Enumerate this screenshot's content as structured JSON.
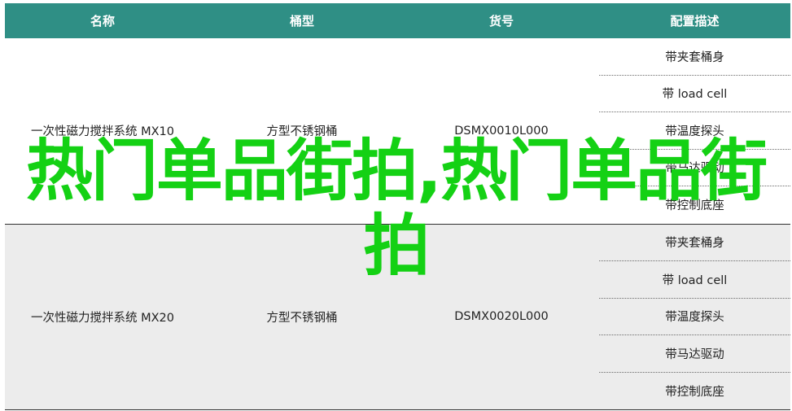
{
  "table": {
    "headers": [
      "名称",
      "桶型",
      "货号",
      "配置描述"
    ],
    "rows": [
      {
        "name": "一次性磁力搅拌系统 MX10",
        "type": "方型不锈钢桶",
        "code": "DSMX0010L000",
        "specs": [
          "带夹套桶身",
          "带 load cell",
          "带温度探头",
          "带马达驱动",
          "带控制底座"
        ]
      },
      {
        "name": "一次性磁力搅拌系统 MX20",
        "type": "方型不锈钢桶",
        "code": "DSMX0020L000",
        "specs": [
          "带夹套桶身",
          "带 load cell",
          "带温度探头",
          "带马达驱动",
          "带控制底座"
        ]
      }
    ]
  },
  "overlay": {
    "text": "热门单品街拍,热门单品街拍"
  },
  "colors": {
    "header_bg": "#2f8f85",
    "overlay_text": "#14d114",
    "alt_row_bg": "#ececec"
  }
}
